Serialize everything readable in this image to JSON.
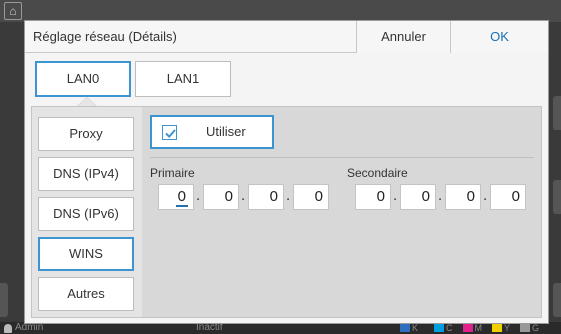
{
  "status": {
    "user": "Admin",
    "state": "Inactif",
    "inks": [
      "K",
      "C",
      "M",
      "Y",
      "G"
    ],
    "ink_colors": [
      "#2f6fc0",
      "#00a0e0",
      "#e0208c",
      "#f0d000",
      "#999999"
    ]
  },
  "dialog": {
    "title": "Réglage réseau (Détails)",
    "cancel_label": "Annuler",
    "ok_label": "OK"
  },
  "lan_tabs": [
    {
      "label": "LAN0",
      "active": true
    },
    {
      "label": "LAN1",
      "active": false
    }
  ],
  "side_menu": [
    {
      "label": "Proxy",
      "active": false
    },
    {
      "label": "DNS (IPv4)",
      "active": false
    },
    {
      "label": "DNS (IPv6)",
      "active": false
    },
    {
      "label": "WINS",
      "active": true
    },
    {
      "label": "Autres",
      "active": false
    }
  ],
  "wins": {
    "use_label": "Utiliser",
    "use_checked": true,
    "primary_label": "Primaire",
    "secondary_label": "Secondaire",
    "primary": [
      "0",
      "0",
      "0",
      "0"
    ],
    "secondary": [
      "0",
      "0",
      "0",
      "0"
    ]
  },
  "colors": {
    "accent": "#3c94d0",
    "ok_text": "#1a6fb5"
  }
}
